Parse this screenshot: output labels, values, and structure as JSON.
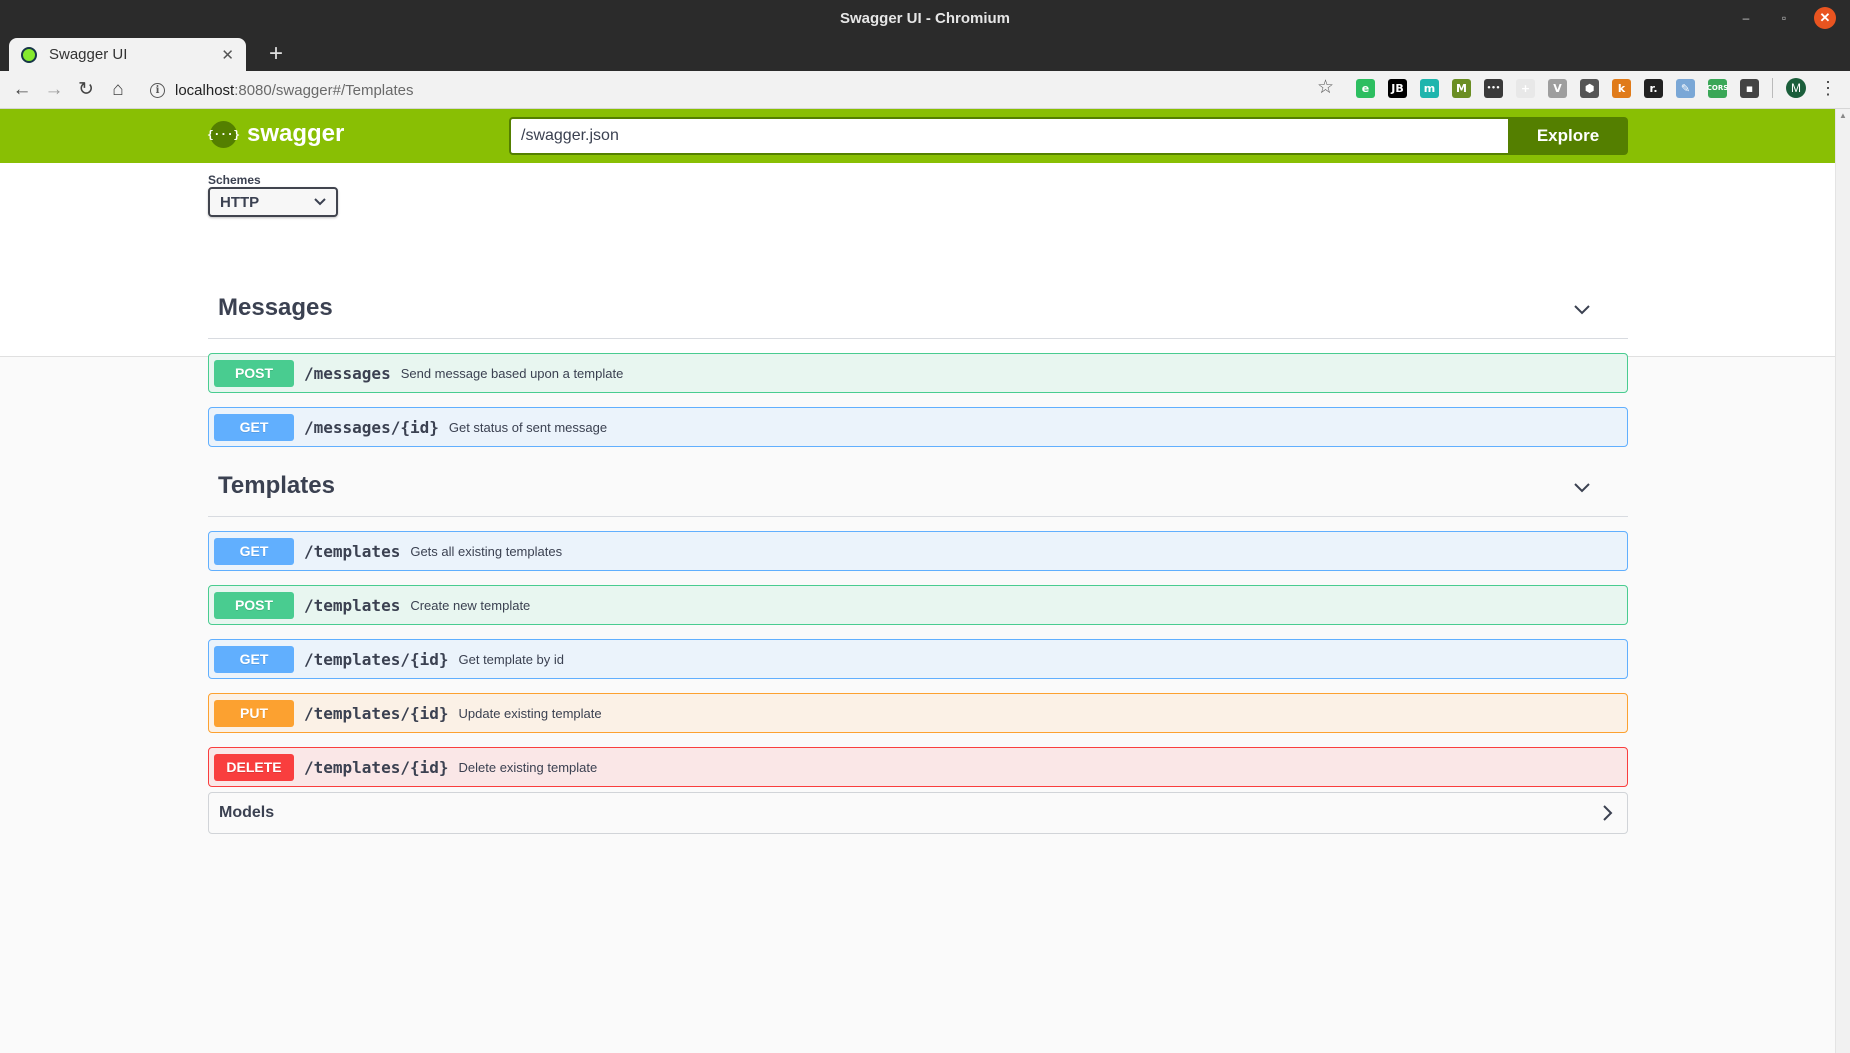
{
  "window": {
    "title": "Swagger UI - Chromium",
    "minimize_glyph": "–",
    "maximize_glyph": "▫",
    "close_glyph": "✕"
  },
  "tab": {
    "title": "Swagger UI",
    "close_glyph": "✕",
    "new_tab_glyph": "+"
  },
  "browser": {
    "back_glyph": "←",
    "forward_glyph": "→",
    "reload_glyph": "↻",
    "home_glyph": "⌂",
    "info_glyph": "i",
    "url_host": "localhost",
    "url_rest": ":8080/swagger#/Templates",
    "star_glyph": "☆",
    "extensions": [
      {
        "icon": "evernote-icon",
        "label": "e",
        "color": "#2dbe60"
      },
      {
        "icon": "jetbrains-icon",
        "label": "JB",
        "color": "#000000"
      },
      {
        "icon": "m-circle-icon",
        "label": "m",
        "color": "#1fb5ad"
      },
      {
        "icon": "m-square-icon",
        "label": "M",
        "color": "#6b8e23"
      },
      {
        "icon": "password-icon",
        "label": "•••",
        "color": "#3a3a3a"
      },
      {
        "icon": "shield-plus-icon",
        "label": "+",
        "color": "#e8e8e8"
      },
      {
        "icon": "vue-icon",
        "label": "V",
        "color": "#9e9e9e"
      },
      {
        "icon": "hexagon-icon",
        "label": "⬢",
        "color": "#555555"
      },
      {
        "icon": "k-icon",
        "label": "k",
        "color": "#e07b1a"
      },
      {
        "icon": "r-icon",
        "label": "r.",
        "color": "#222222"
      },
      {
        "icon": "feather-icon",
        "label": "✎",
        "color": "#7aa7d6"
      },
      {
        "icon": "cors-icon",
        "label": "CORS",
        "color": "#3aa757"
      },
      {
        "icon": "save-icon",
        "label": "▪",
        "color": "#444444"
      }
    ],
    "profile_initial": "M",
    "menu_glyph": "⋮"
  },
  "swagger": {
    "logo_mark": "{···}",
    "logo_text": "swagger",
    "url_value": "/swagger.json",
    "explore_label": "Explore",
    "schemes_label": "Schemes",
    "schemes_value": "HTTP",
    "schemes_chevron": "⌄"
  },
  "tags": [
    {
      "name": "Messages",
      "operations": [
        {
          "method": "POST",
          "cls": "post",
          "path": "/messages",
          "summary": "Send message based upon a template"
        },
        {
          "method": "GET",
          "cls": "get",
          "path": "/messages/{id}",
          "summary": "Get status of sent message"
        }
      ]
    },
    {
      "name": "Templates",
      "operations": [
        {
          "method": "GET",
          "cls": "get",
          "path": "/templates",
          "summary": "Gets all existing templates"
        },
        {
          "method": "POST",
          "cls": "post",
          "path": "/templates",
          "summary": "Create new template"
        },
        {
          "method": "GET",
          "cls": "get",
          "path": "/templates/{id}",
          "summary": "Get template by id"
        },
        {
          "method": "PUT",
          "cls": "put",
          "path": "/templates/{id}",
          "summary": "Update existing template"
        },
        {
          "method": "DELETE",
          "cls": "delete",
          "path": "/templates/{id}",
          "summary": "Delete existing template"
        }
      ]
    }
  ],
  "models": {
    "title": "Models"
  },
  "colors": {
    "topbar": "#89bf04",
    "topbar_dark": "#547f00",
    "post": "#49cc90",
    "get": "#61affe",
    "put": "#fca130",
    "delete": "#f93e3e"
  }
}
